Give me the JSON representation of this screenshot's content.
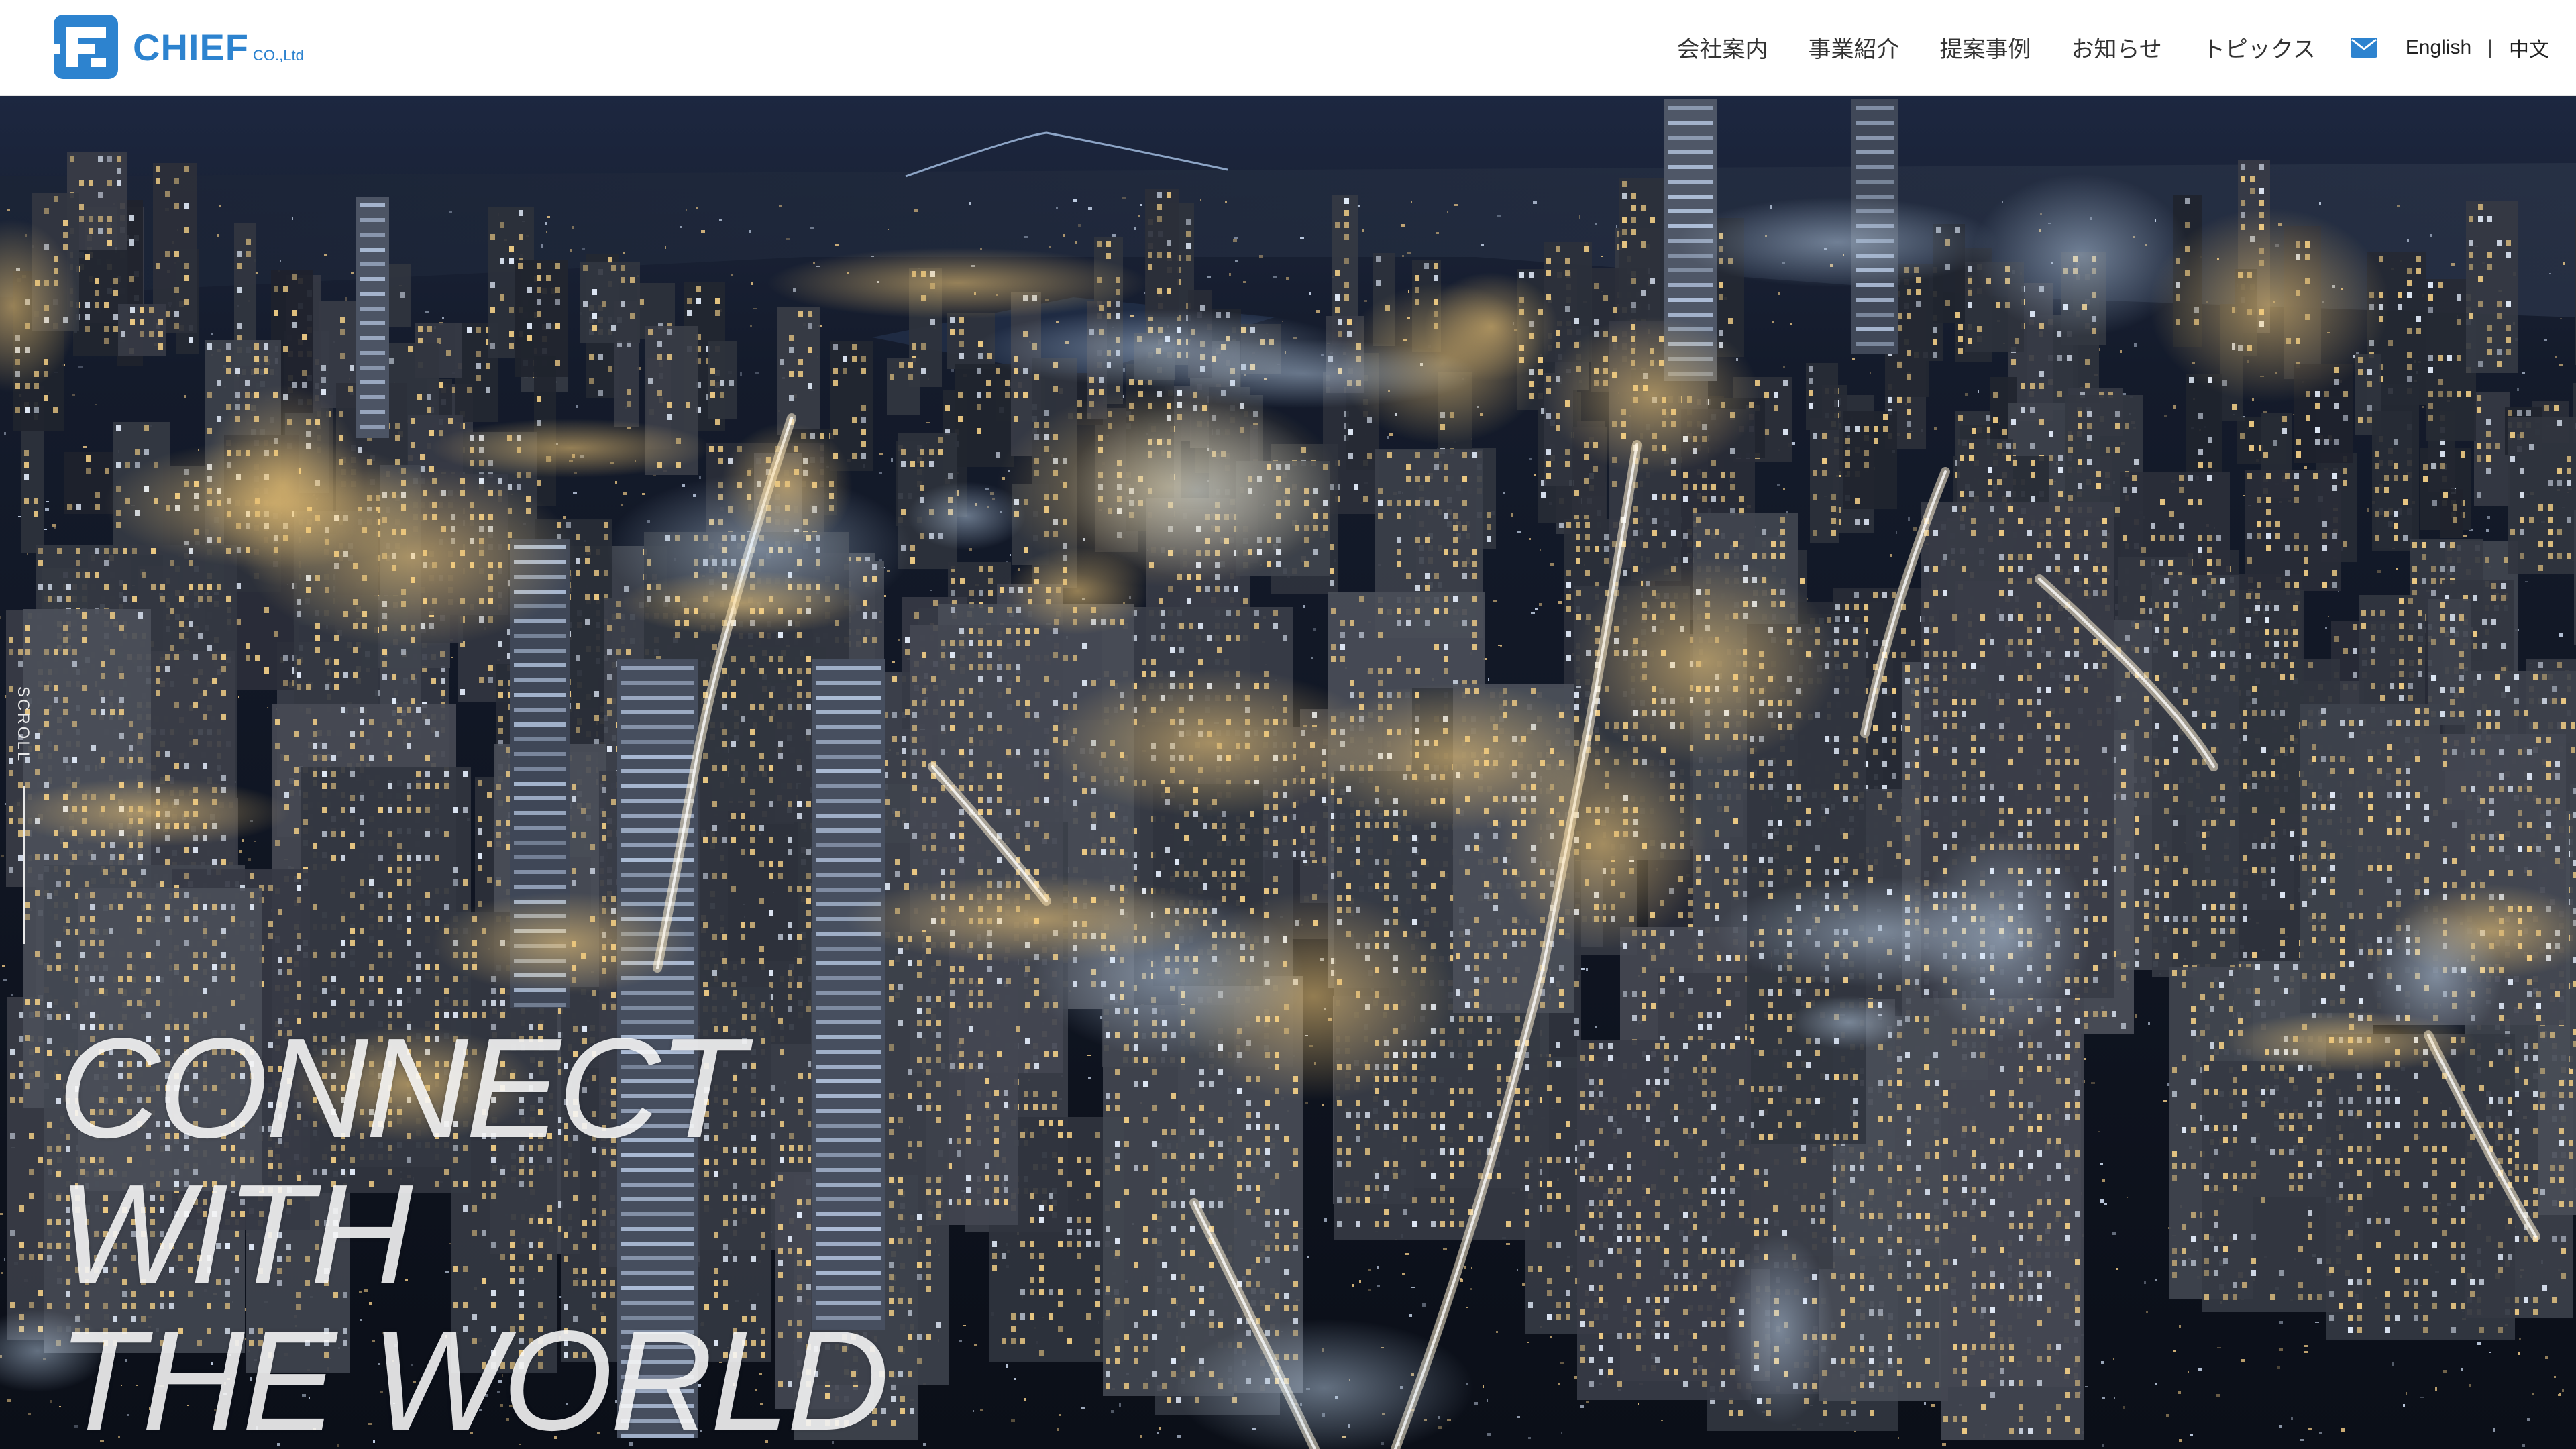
{
  "brand": {
    "name": "CHIEF",
    "suffix": "CO.,Ltd",
    "color": "#2d83cf"
  },
  "nav": {
    "items": [
      {
        "label": "会社案内"
      },
      {
        "label": "事業紹介"
      },
      {
        "label": "提案事例"
      },
      {
        "label": "お知らせ"
      },
      {
        "label": "トピックス"
      }
    ],
    "contact_icon": "mail-icon",
    "languages": {
      "english": "English",
      "separator": "|",
      "chinese": "中文"
    }
  },
  "hero": {
    "scroll_label": "SCROLL",
    "headline": [
      "CONNECT",
      "WITH",
      "THE WORLD"
    ],
    "background": "night-city-aerial-photo"
  }
}
